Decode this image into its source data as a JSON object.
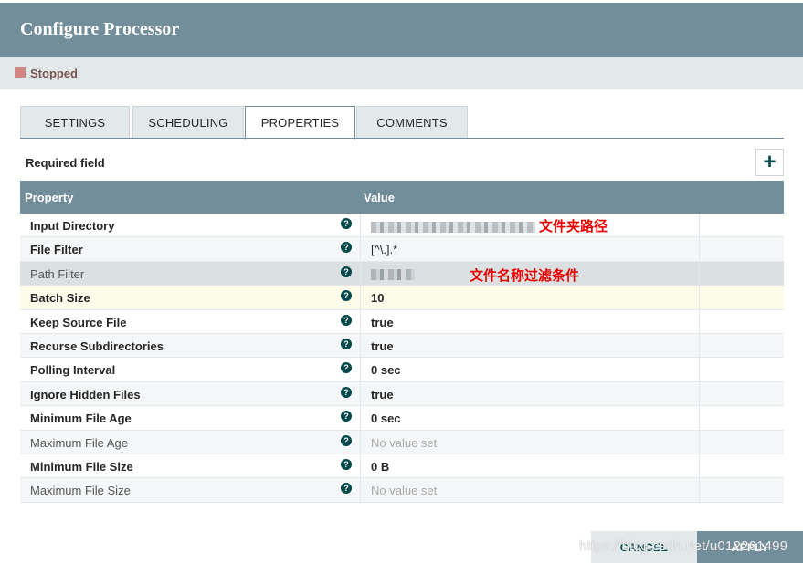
{
  "header": {
    "title": "Configure Processor"
  },
  "status": {
    "text": "Stopped",
    "color": "#d18686"
  },
  "tabs": [
    {
      "label": "SETTINGS",
      "active": false
    },
    {
      "label": "SCHEDULING",
      "active": false
    },
    {
      "label": "PROPERTIES",
      "active": true
    },
    {
      "label": "COMMENTS",
      "active": false
    }
  ],
  "required_field_label": "Required field",
  "add_icon": "plus-icon",
  "table": {
    "columns": [
      "Property",
      "Value"
    ],
    "rows": [
      {
        "name": "Input Directory",
        "value": "",
        "redacted": true,
        "required": true,
        "annotation": "文件夹路径"
      },
      {
        "name": "File Filter",
        "value": "[^\\.].*",
        "required": true
      },
      {
        "name": "Path Filter",
        "value": "",
        "redacted": true,
        "required": false,
        "annotation": "文件名称过滤条件"
      },
      {
        "name": "Batch Size",
        "value": "10",
        "required": true
      },
      {
        "name": "Keep Source File",
        "value": "true",
        "required": true
      },
      {
        "name": "Recurse Subdirectories",
        "value": "true",
        "required": true
      },
      {
        "name": "Polling Interval",
        "value": "0 sec",
        "required": true
      },
      {
        "name": "Ignore Hidden Files",
        "value": "true",
        "required": true
      },
      {
        "name": "Minimum File Age",
        "value": "0 sec",
        "required": true
      },
      {
        "name": "Maximum File Age",
        "value": "No value set",
        "required": false,
        "empty": true
      },
      {
        "name": "Minimum File Size",
        "value": "0 B",
        "required": true
      },
      {
        "name": "Maximum File Size",
        "value": "No value set",
        "required": false,
        "empty": true
      }
    ]
  },
  "footer": {
    "cancel_label": "CANCEL",
    "apply_label": "APPLY"
  },
  "watermark": "https://blog.csdn.net/u012261499",
  "colors": {
    "header": "#728e9b",
    "accent": "#004849",
    "stopped": "#d18686",
    "annotation": "#e60000"
  }
}
